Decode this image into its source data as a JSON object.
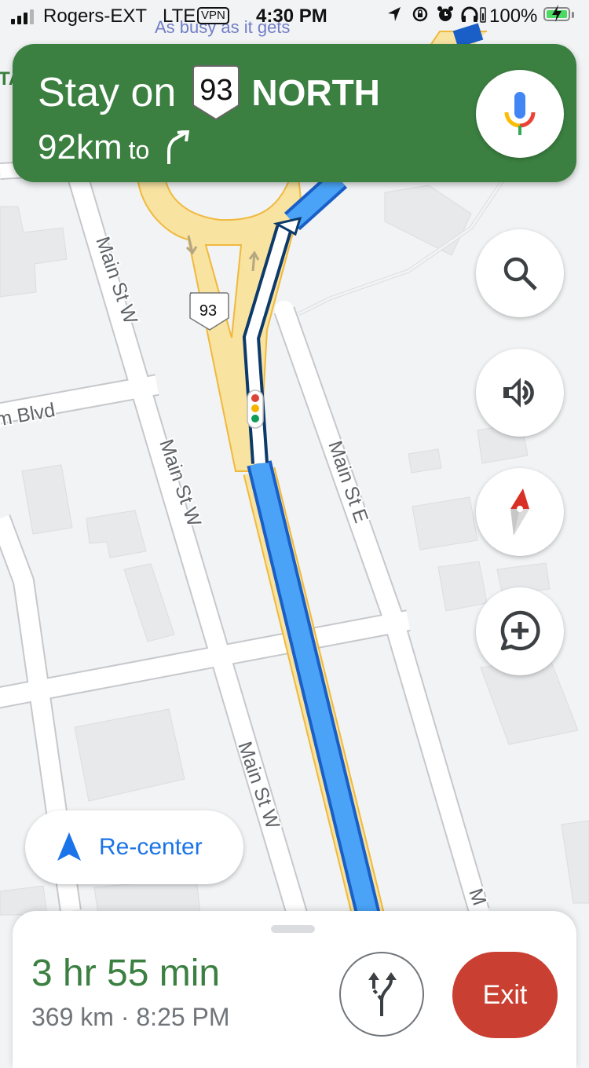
{
  "status_bar": {
    "carrier": "Rogers-EXT",
    "network": "LTE",
    "vpn": "VPN",
    "time": "4:30 PM",
    "battery_percent": "100%",
    "signal_bars": 3,
    "signal_max": 4,
    "icons": [
      "location-arrow-icon",
      "rotation-lock-icon",
      "alarm-icon",
      "headphones-icon",
      "charging-battery-icon"
    ]
  },
  "map_overlay": {
    "busy_text": "As busy as it gets",
    "partial_label": "TA"
  },
  "navigation": {
    "instruction_prefix": "Stay on",
    "route_number": "93",
    "direction": "NORTH",
    "distance": "92km",
    "to_label": "to",
    "next_maneuver": "slight-right-arrow"
  },
  "map": {
    "route_shield": "93",
    "street_labels": [
      "Main St W",
      "Main St W",
      "Main St W",
      "Main St E",
      "m Blvd",
      "M"
    ],
    "colors": {
      "background": "#f1f3f4",
      "road": "#ffffff",
      "highway": "#f8e3a1",
      "highway_border": "#f0b93d",
      "route": "#4aa3f7",
      "route_border": "#1a5fc7",
      "building": "#e8e9eb"
    }
  },
  "controls": {
    "search": "search-icon",
    "sound": "volume-icon",
    "compass": "compass-icon",
    "report": "add-report-icon",
    "recenter_label": "Re-center"
  },
  "trip": {
    "duration": "3 hr 55 min",
    "distance": "369 km",
    "separator": "·",
    "arrival": "8:25 PM",
    "exit_label": "Exit"
  },
  "colors": {
    "nav_green": "#3b7f41",
    "exit_red": "#c93f31",
    "link_blue": "#1a73e8"
  }
}
